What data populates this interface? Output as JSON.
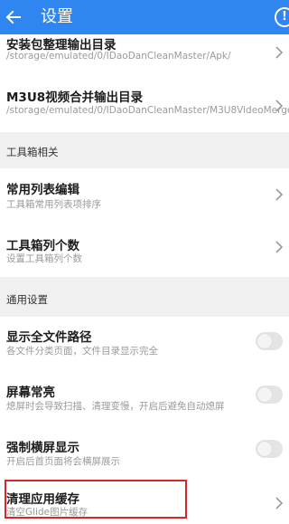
{
  "header": {
    "title": "设置",
    "back_icon": "arrow-left-icon",
    "help_icon": "exclamation-circle-icon",
    "help_glyph": "!",
    "background": "#2f86f1"
  },
  "rows": [
    {
      "title": "安装包整理输出目录",
      "subtitle": "/storage/emulated/0/IDaoDanCleanMaster/Apk/",
      "control": "chevron"
    },
    {
      "title": "M3U8视频合并输出目录",
      "subtitle": "/storage/emulated/0/IDaoDanCleanMaster/M3U8VideoMerge/",
      "control": "chevron"
    }
  ],
  "sections": [
    {
      "label": "工具箱相关",
      "items": [
        {
          "title": "常用列表编辑",
          "subtitle": "工具箱常用列表项排序",
          "control": "chevron"
        },
        {
          "title": "工具箱列个数",
          "subtitle": "设置工具箱列个数",
          "control": "chevron"
        }
      ]
    },
    {
      "label": "通用设置",
      "items": [
        {
          "title": "显示全文件路径",
          "subtitle": "各文件分类页面，文件目录显示完全",
          "control": "toggle",
          "on": false
        },
        {
          "title": "屏幕常亮",
          "subtitle": "熄屏时会导致扫描、清理变慢，开启后避免自动熄屏",
          "control": "toggle",
          "on": false
        },
        {
          "title": "强制横屏显示",
          "subtitle": "开启后首页面将会横屏展示",
          "control": "toggle",
          "on": false
        },
        {
          "title": "清理应用缓存",
          "subtitle": "清空Glide图片缓存",
          "control": "chevron",
          "highlighted": true
        }
      ]
    }
  ],
  "colors": {
    "highlight_border": "#d9262b",
    "section_bg": "#f0f0f0",
    "toggle_off": "#e4e4e4"
  }
}
